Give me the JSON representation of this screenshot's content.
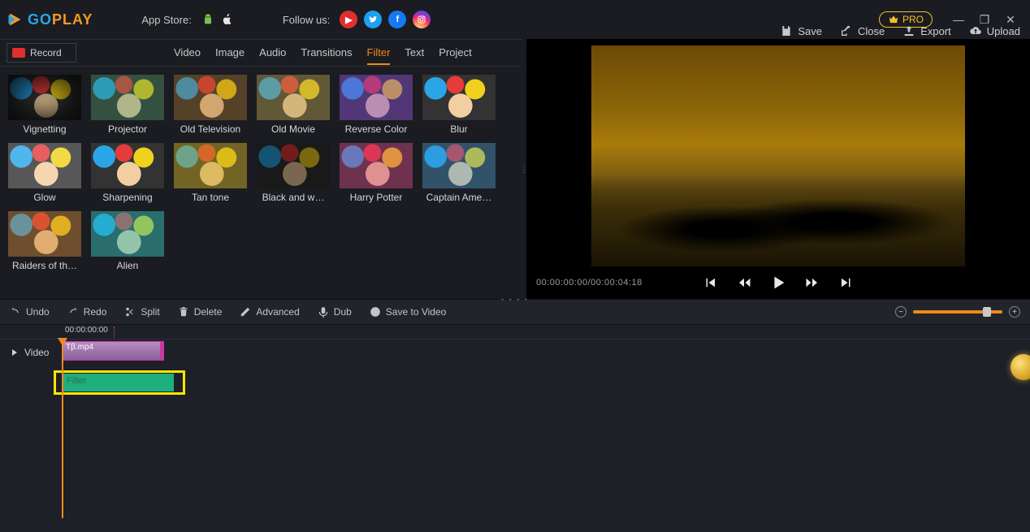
{
  "brand": {
    "name_part1": "GO",
    "name_part2": "PLAY"
  },
  "appstore": {
    "label": "App Store:"
  },
  "follow": {
    "label": "Follow us:"
  },
  "pro_label": "PRO",
  "actions": {
    "save": "Save",
    "close": "Close",
    "export": "Export",
    "upload": "Upload"
  },
  "record": "Record",
  "tabs": {
    "video": "Video",
    "image": "Image",
    "audio": "Audio",
    "transitions": "Transitions",
    "filter": "Filter",
    "text": "Text",
    "project": "Project",
    "active": "filter"
  },
  "filters": [
    {
      "label": "Vignetting",
      "ov": "ov-vig"
    },
    {
      "label": "Projector",
      "ov": "ov-proj"
    },
    {
      "label": "Old Television",
      "ov": "ov-tv"
    },
    {
      "label": "Old Movie",
      "ov": "ov-movie"
    },
    {
      "label": "Reverse Color",
      "ov": "ov-rev"
    },
    {
      "label": "Blur",
      "ov": "ov-blur"
    },
    {
      "label": "Glow",
      "ov": "ov-glow"
    },
    {
      "label": "Sharpening",
      "ov": "ov-sharp"
    },
    {
      "label": "Tan tone",
      "ov": "ov-tan"
    },
    {
      "label": "Black and w…",
      "ov": "ov-bw"
    },
    {
      "label": "Harry Potter",
      "ov": "ov-hp"
    },
    {
      "label": "Captain Ame…",
      "ov": "ov-cap"
    },
    {
      "label": "Raiders of th…",
      "ov": "ov-raid"
    },
    {
      "label": "Alien",
      "ov": "ov-alien"
    }
  ],
  "preview": {
    "timecode": "00:00:00:00/00:00:04:18"
  },
  "tools": {
    "undo": "Undo",
    "redo": "Redo",
    "split": "Split",
    "delete": "Delete",
    "advanced": "Advanced",
    "dub": "Dub",
    "save_to_video": "Save to Video"
  },
  "timeline": {
    "ruler_tc": "00:00:00:00",
    "track_label": "Video",
    "clip_name": "Tβ.mp4",
    "filter_clip_label": "Filter"
  }
}
